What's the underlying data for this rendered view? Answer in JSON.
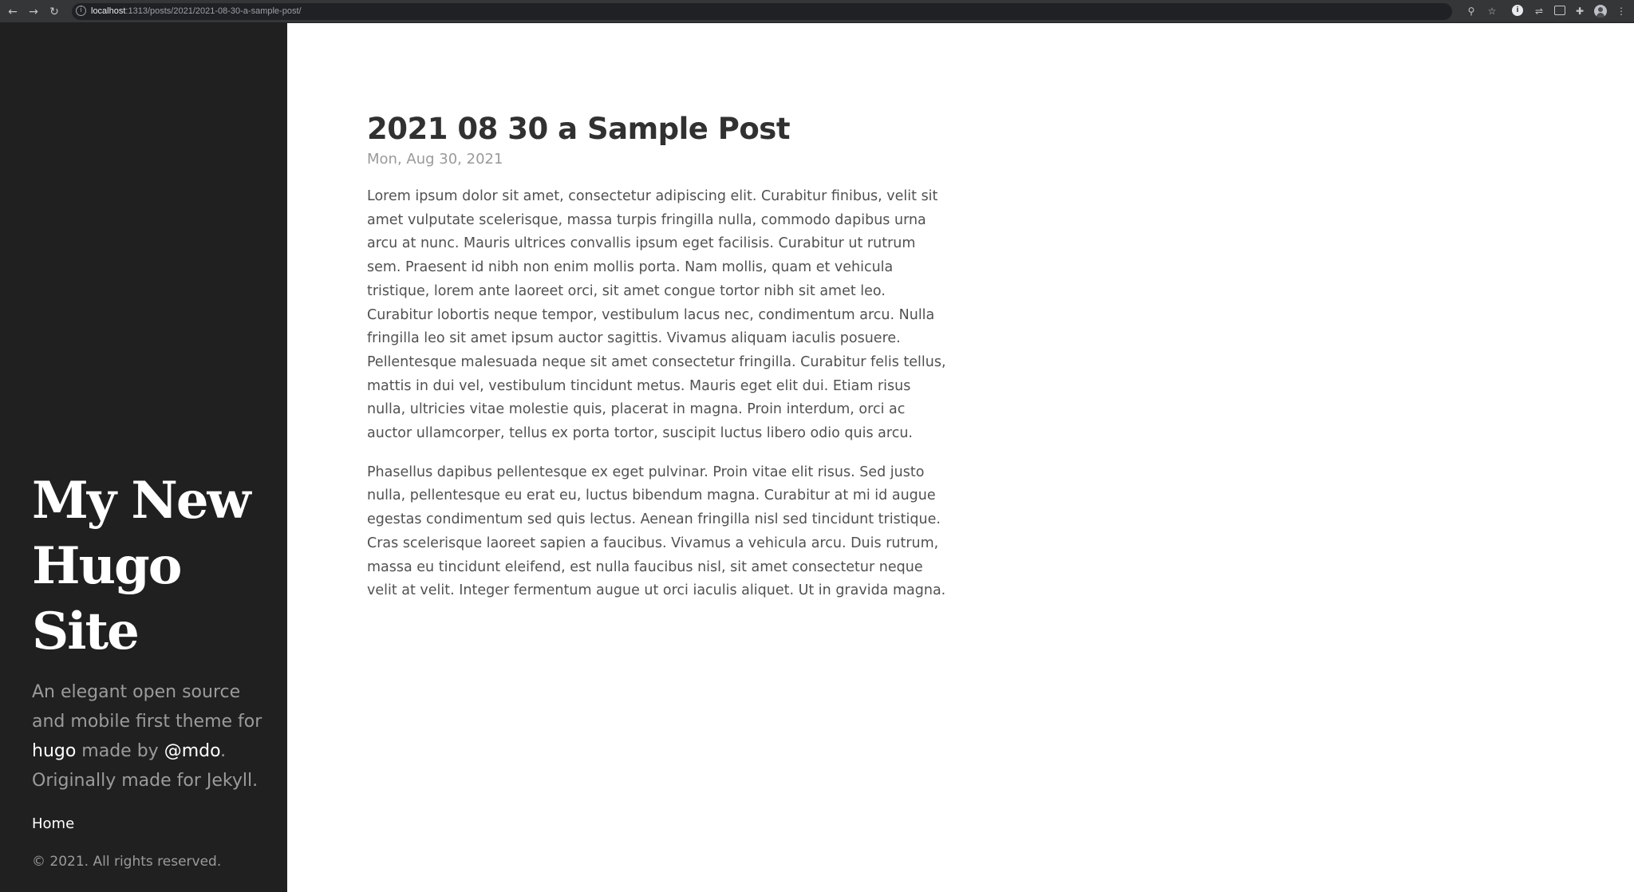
{
  "browser": {
    "url_host": "localhost",
    "url_path": ":1313/posts/2021/2021-08-30-a-sample-post/",
    "icons": [
      "back-arrow-icon",
      "forward-arrow-icon",
      "reload-icon",
      "site-info-icon",
      "zoom-icon",
      "bookmark-star-icon",
      "extension-icon",
      "extension-icon",
      "tab-icon",
      "puzzle-extensions-icon",
      "profile-icon",
      "menu-kebab-icon"
    ]
  },
  "sidebar": {
    "title_line1": "My New",
    "title_line2": "Hugo",
    "title_line3": "Site",
    "tagline_part1": "An elegant open source and mobile first theme for ",
    "tagline_link1": "hugo",
    "tagline_part2": " made by ",
    "tagline_link2": "@mdo",
    "tagline_part3": ". Originally made for Jekyll.",
    "nav_home": "Home",
    "copyright": "© 2021. All rights reserved."
  },
  "post": {
    "title": "2021 08 30 a Sample Post",
    "date": "Mon, Aug 30, 2021",
    "paragraph1": "Lorem ipsum dolor sit amet, consectetur adipiscing elit. Curabitur finibus, velit sit amet vulputate scelerisque, massa turpis fringilla nulla, commodo dapibus urna arcu at nunc. Mauris ultrices convallis ipsum eget facilisis. Curabitur ut rutrum sem. Praesent id nibh non enim mollis porta. Nam mollis, quam et vehicula tristique, lorem ante laoreet orci, sit amet congue tortor nibh sit amet leo. Curabitur lobortis neque tempor, vestibulum lacus nec, condimentum arcu. Nulla fringilla leo sit amet ipsum auctor sagittis. Vivamus aliquam iaculis posuere. Pellentesque malesuada neque sit amet consectetur fringilla. Curabitur felis tellus, mattis in dui vel, vestibulum tincidunt metus. Mauris eget elit dui. Etiam risus nulla, ultricies vitae molestie quis, placerat in magna. Proin interdum, orci ac auctor ullamcorper, tellus ex porta tortor, suscipit luctus libero odio quis arcu.",
    "paragraph2": "Phasellus dapibus pellentesque ex eget pulvinar. Proin vitae elit risus. Sed justo nulla, pellentesque eu erat eu, luctus bibendum magna. Curabitur at mi id augue egestas condimentum sed quis lectus. Aenean fringilla nisl sed tincidunt tristique. Cras scelerisque laoreet sapien a faucibus. Vivamus a vehicula arcu. Duis rutrum, massa eu tincidunt eleifend, est nulla faucibus nisl, sit amet consectetur neque velit at velit. Integer fermentum augue ut orci iaculis aliquet. Ut in gravida magna."
  },
  "colors": {
    "sidebar_bg": "#202020",
    "sidebar_text": "#9b9b9b",
    "sidebar_link": "#ffffff",
    "body_text": "#515151",
    "heading": "#313131"
  }
}
